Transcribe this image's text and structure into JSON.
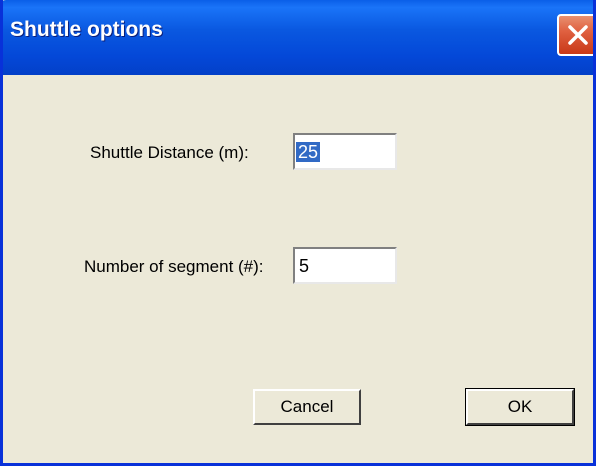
{
  "window": {
    "title": "Shuttle options"
  },
  "form": {
    "shuttle_distance_label": "Shuttle Distance (m):",
    "shuttle_distance_value": "25",
    "segments_label": "Number of segment (#):",
    "segments_value": "5"
  },
  "buttons": {
    "cancel_label": "Cancel",
    "ok_label": "OK"
  },
  "colors": {
    "titlebar": "#0A58E0",
    "window_bg": "#ECE9D8",
    "close_button": "#E06040",
    "selection": "#316AC5"
  },
  "icons": {
    "close": "close-icon"
  }
}
